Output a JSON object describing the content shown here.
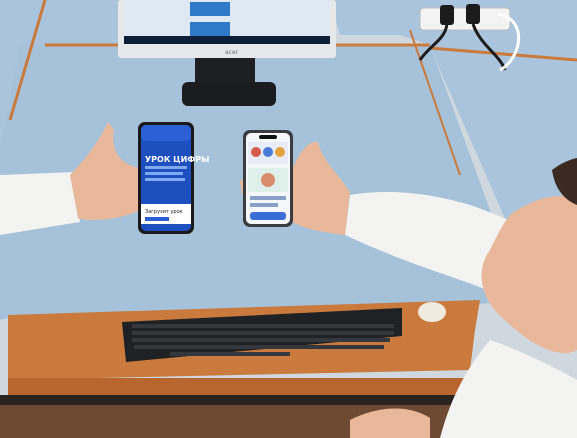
{
  "photo": {
    "monitor_brand": "acer",
    "left_phone": {
      "title": "УРОК ЦИФРЫ",
      "button_label": "Загрузит урок"
    }
  },
  "colors": {
    "desk": "#a9c4dc",
    "desk_edge": "#c97a3c",
    "shirt": "#f3f3f2",
    "skin": "#e9b89b",
    "keyboard": "#1f2124",
    "phone_screen_blue": "#1e4fbf"
  }
}
